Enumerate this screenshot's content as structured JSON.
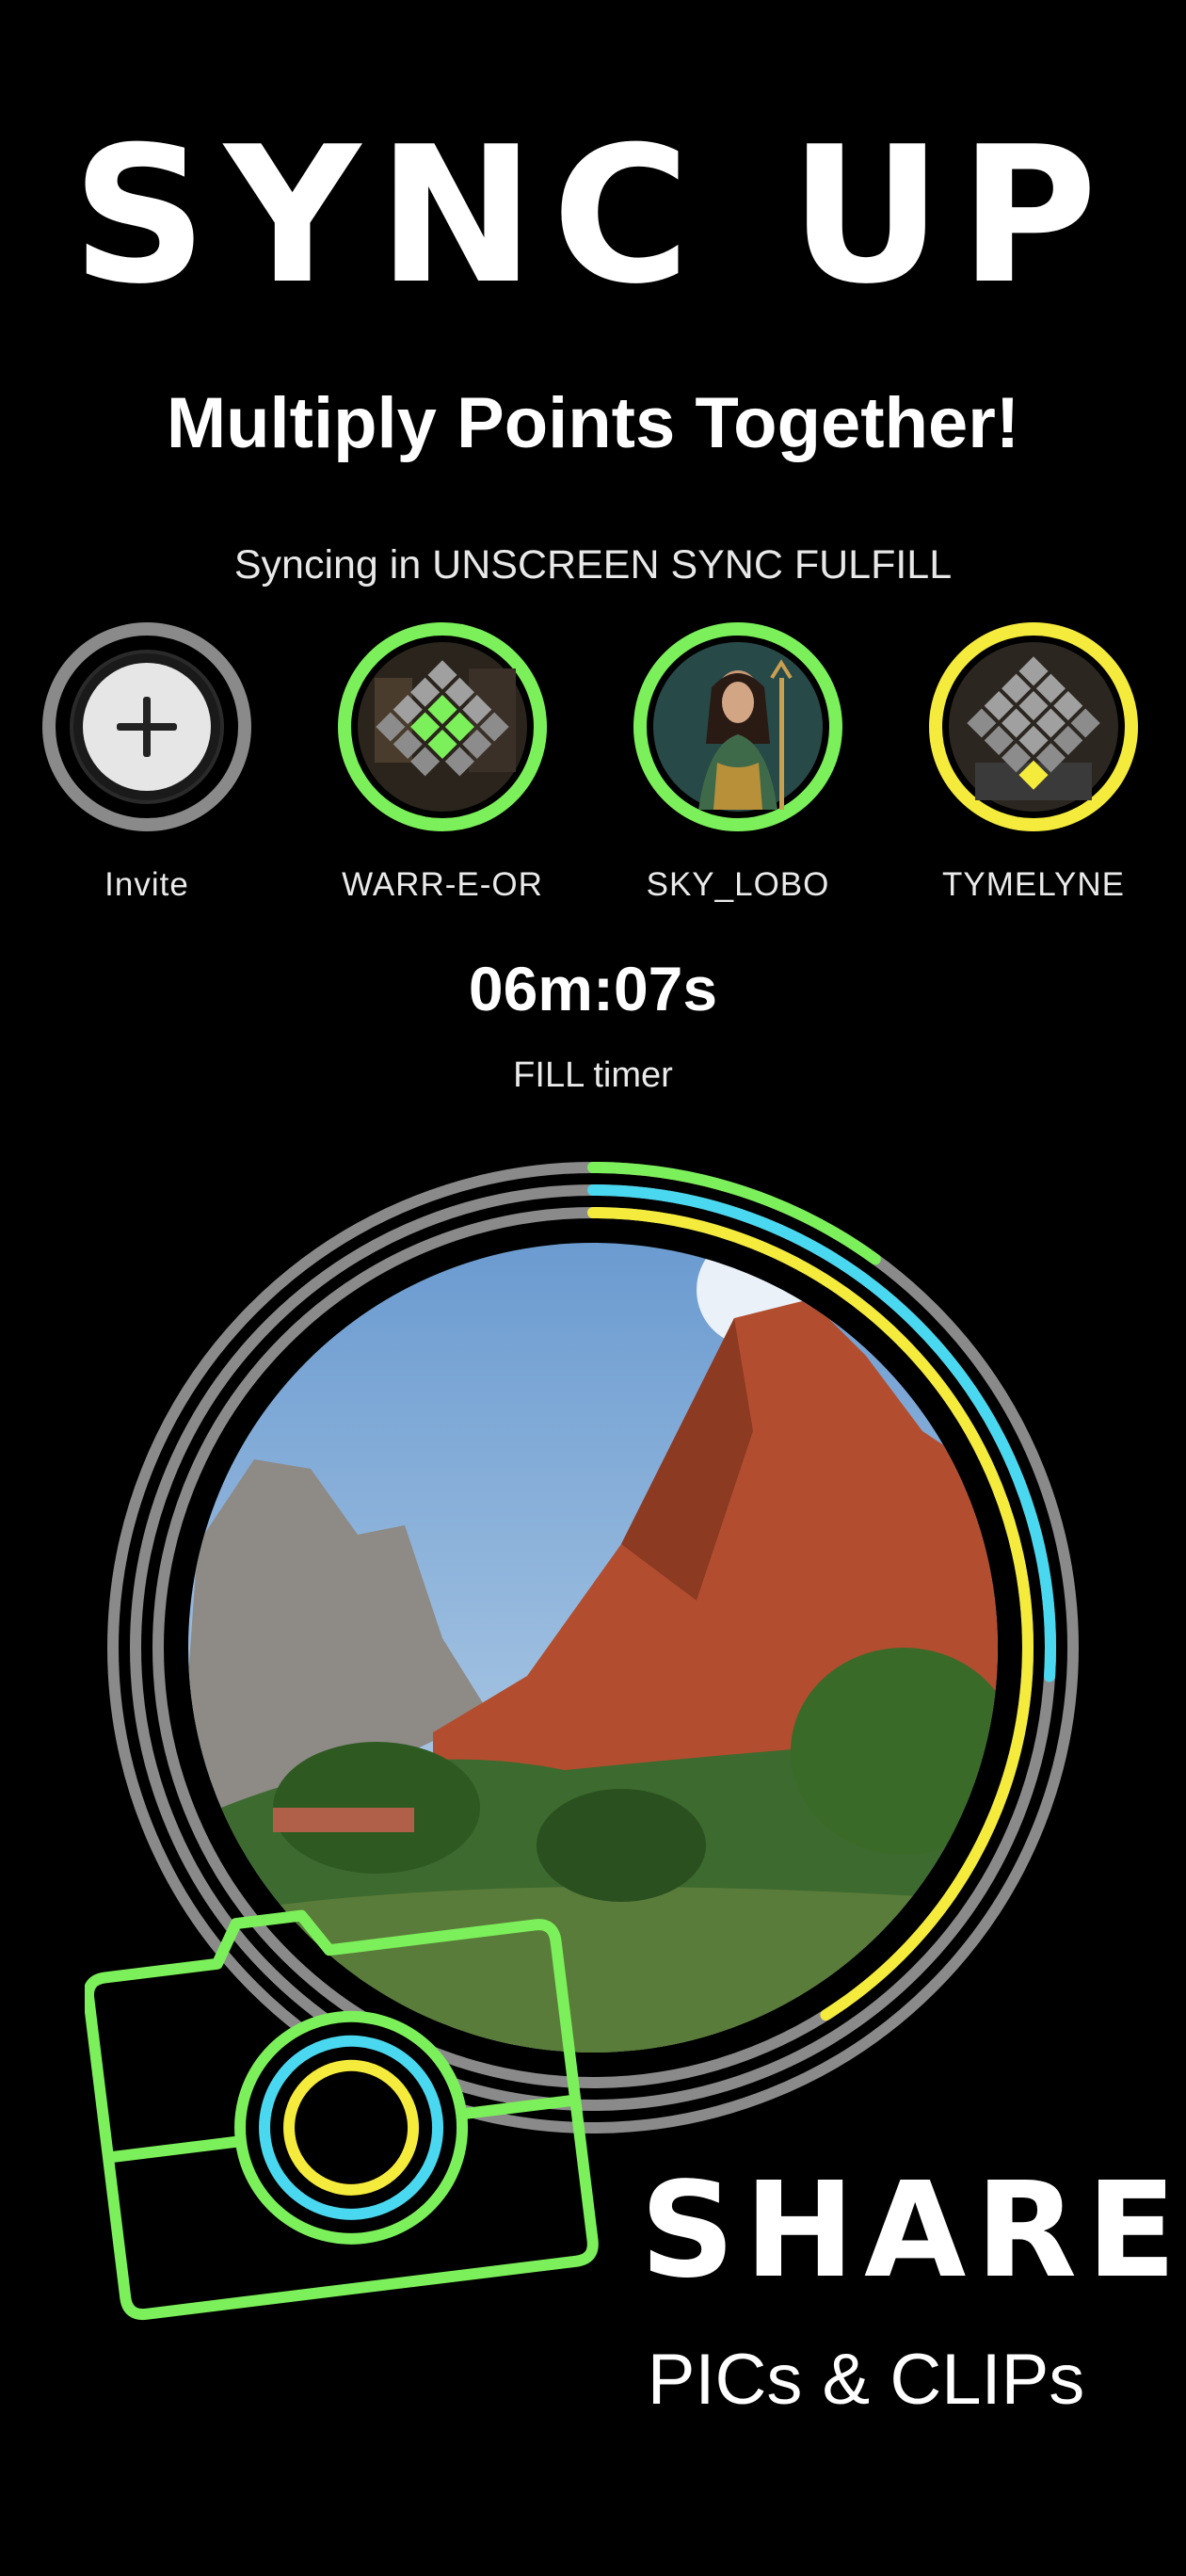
{
  "header": {
    "title": "SYNC UP",
    "subtitle": "Multiply Points Together!"
  },
  "sync": {
    "status_text": "Syncing in UNSCREEN SYNC FULFILL"
  },
  "members": [
    {
      "name": "Invite",
      "ring_color": "#9a9a9a",
      "icon": "plus-icon"
    },
    {
      "name": "WARR-E-OR",
      "ring_color": "#7CF05A",
      "icon": "grid-badge-icon"
    },
    {
      "name": "SKY_LOBO",
      "ring_color": "#7CF05A",
      "icon": "avatar-photo"
    },
    {
      "name": "TYMELYNE",
      "ring_color": "#F5EB3C",
      "icon": "grid-badge-icon"
    }
  ],
  "timer": {
    "value": "06m:07s",
    "label": "FILL timer"
  },
  "progress_rings": [
    {
      "color": "#7CF05A",
      "progress": 0.1
    },
    {
      "color": "#49D8F0",
      "progress": 0.26
    },
    {
      "color": "#F5EB3C",
      "progress": 0.41
    }
  ],
  "promo": {
    "title": "SHARE",
    "subtitle": "PICs & CLIPs"
  },
  "colors": {
    "background": "#000000",
    "green": "#7CF05A",
    "cyan": "#49D8F0",
    "yellow": "#F5EB3C",
    "track": "#8a8a8a"
  },
  "icons": {
    "camera": "camera-icon"
  }
}
